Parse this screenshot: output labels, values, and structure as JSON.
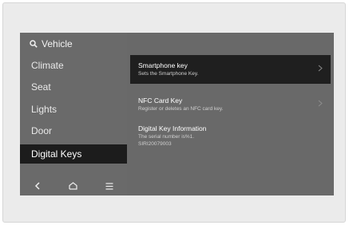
{
  "sidebar": {
    "search_label": "Vehicle",
    "items": [
      {
        "label": "Climate",
        "selected": false
      },
      {
        "label": "Seat",
        "selected": false
      },
      {
        "label": "Lights",
        "selected": false
      },
      {
        "label": "Door",
        "selected": false
      },
      {
        "label": "Digital Keys",
        "selected": true
      }
    ],
    "bottom_nav": [
      {
        "icon": "back-icon"
      },
      {
        "icon": "home-icon"
      },
      {
        "icon": "menu-icon"
      }
    ]
  },
  "main": {
    "items": [
      {
        "title": "Smartphone key",
        "subtitle": "Sets the Smartphone Key.",
        "selected": true,
        "has_chevron": true
      },
      {
        "title": "NFC Card Key",
        "subtitle": "Register or deletes an NFC card key.",
        "selected": false,
        "has_chevron": true
      },
      {
        "title": "Digital Key Information",
        "subtitle": "The serial number is%1.",
        "serial": "SIRI20079003",
        "selected": false,
        "has_chevron": false
      }
    ]
  },
  "colors": {
    "screen_bg": "#696969",
    "selected_bg": "#1c1c1c",
    "text": "#ffffff"
  }
}
